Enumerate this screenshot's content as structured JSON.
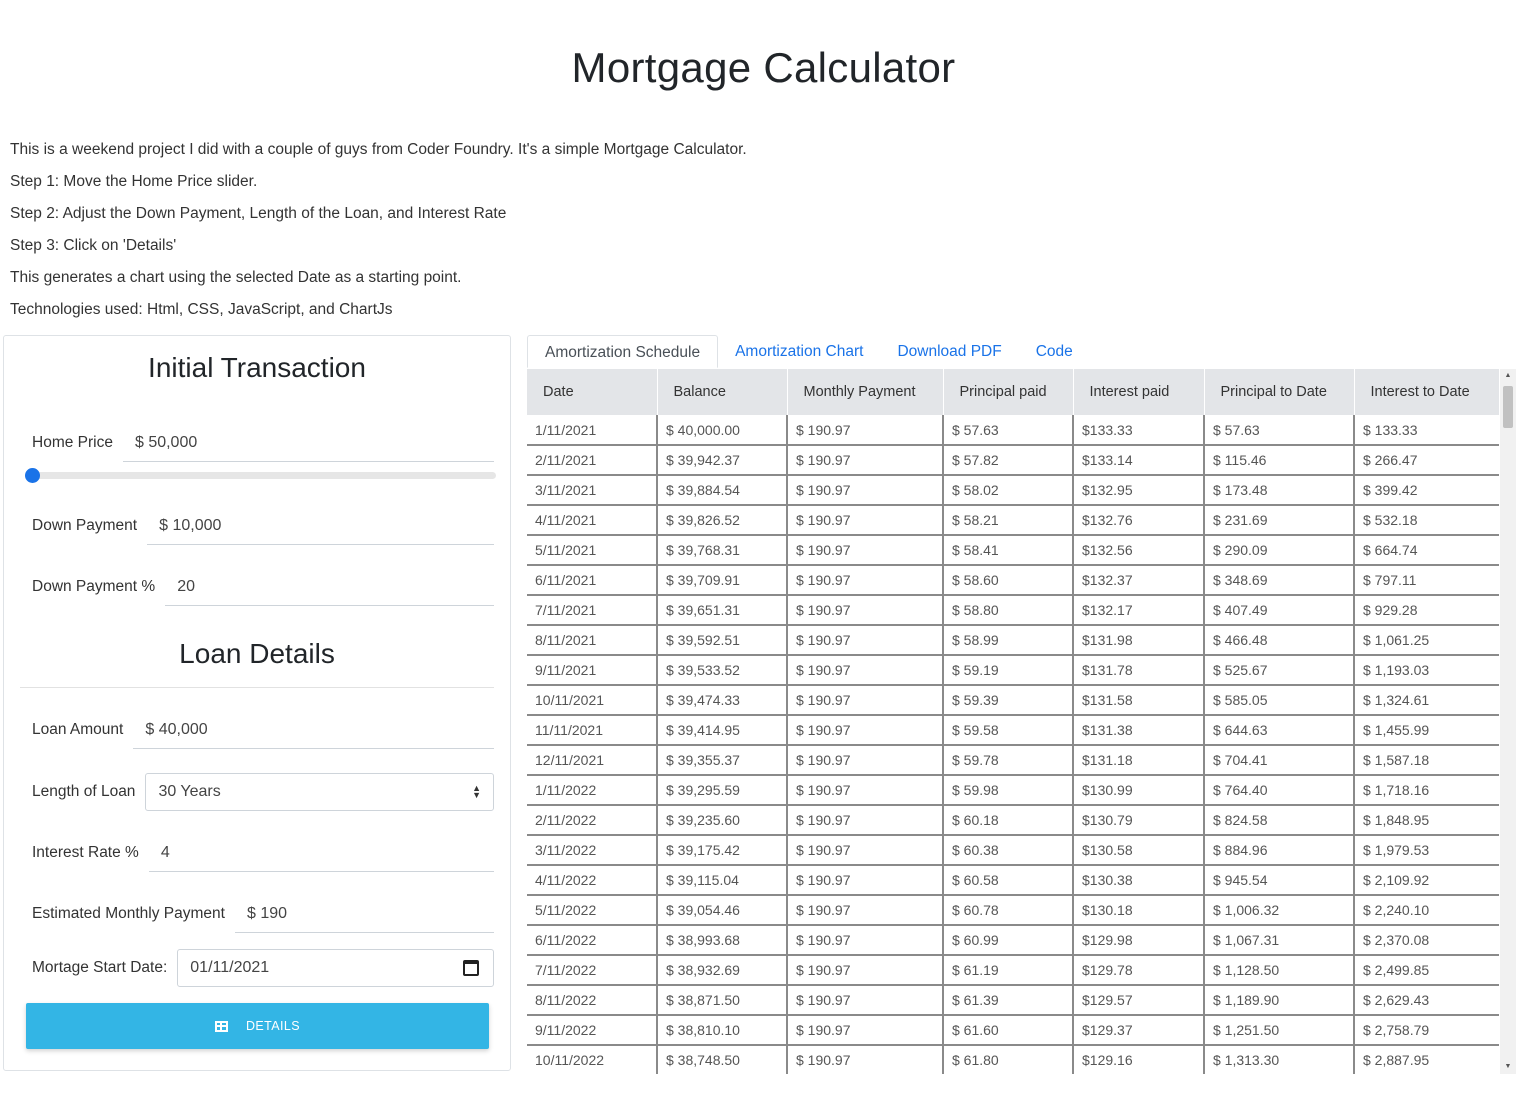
{
  "page": {
    "title": "Mortgage Calculator",
    "intro": [
      "This is a weekend project I did with a couple of guys from Coder Foundry. It's a simple Mortgage Calculator.",
      "Step 1: Move the Home Price slider.",
      "Step 2: Adjust the Down Payment, Length of the Loan, and Interest Rate",
      "Step 3: Click on 'Details'",
      "This generates a chart using the selected Date as a starting point.",
      "Technologies used: Html, CSS, JavaScript, and ChartJs"
    ]
  },
  "initial": {
    "title": "Initial Transaction",
    "home_price_label": "Home Price",
    "home_price_value": "$ 50,000",
    "home_price_slider_fraction": 0.0,
    "down_payment_label": "Down Payment",
    "down_payment_value": "$ 10,000",
    "down_payment_pct_label": "Down Payment %",
    "down_payment_pct_value": "20"
  },
  "loan": {
    "title": "Loan Details",
    "loan_amount_label": "Loan Amount",
    "loan_amount_value": "$ 40,000",
    "length_label": "Length of Loan",
    "length_value": "30 Years",
    "interest_label": "Interest Rate %",
    "interest_value": "4",
    "monthly_label": "Estimated Monthly Payment",
    "monthly_value": "$ 190",
    "start_date_label": "Mortage Start Date:",
    "start_date_value": "01/11/2021",
    "details_button": "Details"
  },
  "tabs": [
    "Amortization Schedule",
    "Amortization Chart",
    "Download PDF",
    "Code"
  ],
  "colors": {
    "accent": "#33b5e5",
    "link": "#1a73e8",
    "header_bg": "#e3e5e8"
  },
  "table": {
    "headers": [
      "Date",
      "Balance",
      "Monthly Payment",
      "Principal paid",
      "Interest paid",
      "Principal to Date",
      "Interest to Date"
    ],
    "rows": [
      [
        "1/11/2021",
        "$ 40,000.00",
        "$ 190.97",
        "$ 57.63",
        "$133.33",
        "$ 57.63",
        "$ 133.33"
      ],
      [
        "2/11/2021",
        "$ 39,942.37",
        "$ 190.97",
        "$ 57.82",
        "$133.14",
        "$ 115.46",
        "$ 266.47"
      ],
      [
        "3/11/2021",
        "$ 39,884.54",
        "$ 190.97",
        "$ 58.02",
        "$132.95",
        "$ 173.48",
        "$ 399.42"
      ],
      [
        "4/11/2021",
        "$ 39,826.52",
        "$ 190.97",
        "$ 58.21",
        "$132.76",
        "$ 231.69",
        "$ 532.18"
      ],
      [
        "5/11/2021",
        "$ 39,768.31",
        "$ 190.97",
        "$ 58.41",
        "$132.56",
        "$ 290.09",
        "$ 664.74"
      ],
      [
        "6/11/2021",
        "$ 39,709.91",
        "$ 190.97",
        "$ 58.60",
        "$132.37",
        "$ 348.69",
        "$ 797.11"
      ],
      [
        "7/11/2021",
        "$ 39,651.31",
        "$ 190.97",
        "$ 58.80",
        "$132.17",
        "$ 407.49",
        "$ 929.28"
      ],
      [
        "8/11/2021",
        "$ 39,592.51",
        "$ 190.97",
        "$ 58.99",
        "$131.98",
        "$ 466.48",
        "$ 1,061.25"
      ],
      [
        "9/11/2021",
        "$ 39,533.52",
        "$ 190.97",
        "$ 59.19",
        "$131.78",
        "$ 525.67",
        "$ 1,193.03"
      ],
      [
        "10/11/2021",
        "$ 39,474.33",
        "$ 190.97",
        "$ 59.39",
        "$131.58",
        "$ 585.05",
        "$ 1,324.61"
      ],
      [
        "11/11/2021",
        "$ 39,414.95",
        "$ 190.97",
        "$ 59.58",
        "$131.38",
        "$ 644.63",
        "$ 1,455.99"
      ],
      [
        "12/11/2021",
        "$ 39,355.37",
        "$ 190.97",
        "$ 59.78",
        "$131.18",
        "$ 704.41",
        "$ 1,587.18"
      ],
      [
        "1/11/2022",
        "$ 39,295.59",
        "$ 190.97",
        "$ 59.98",
        "$130.99",
        "$ 764.40",
        "$ 1,718.16"
      ],
      [
        "2/11/2022",
        "$ 39,235.60",
        "$ 190.97",
        "$ 60.18",
        "$130.79",
        "$ 824.58",
        "$ 1,848.95"
      ],
      [
        "3/11/2022",
        "$ 39,175.42",
        "$ 190.97",
        "$ 60.38",
        "$130.58",
        "$ 884.96",
        "$ 1,979.53"
      ],
      [
        "4/11/2022",
        "$ 39,115.04",
        "$ 190.97",
        "$ 60.58",
        "$130.38",
        "$ 945.54",
        "$ 2,109.92"
      ],
      [
        "5/11/2022",
        "$ 39,054.46",
        "$ 190.97",
        "$ 60.78",
        "$130.18",
        "$ 1,006.32",
        "$ 2,240.10"
      ],
      [
        "6/11/2022",
        "$ 38,993.68",
        "$ 190.97",
        "$ 60.99",
        "$129.98",
        "$ 1,067.31",
        "$ 2,370.08"
      ],
      [
        "7/11/2022",
        "$ 38,932.69",
        "$ 190.97",
        "$ 61.19",
        "$129.78",
        "$ 1,128.50",
        "$ 2,499.85"
      ],
      [
        "8/11/2022",
        "$ 38,871.50",
        "$ 190.97",
        "$ 61.39",
        "$129.57",
        "$ 1,189.90",
        "$ 2,629.43"
      ],
      [
        "9/11/2022",
        "$ 38,810.10",
        "$ 190.97",
        "$ 61.60",
        "$129.37",
        "$ 1,251.50",
        "$ 2,758.79"
      ],
      [
        "10/11/2022",
        "$ 38,748.50",
        "$ 190.97",
        "$ 61.80",
        "$129.16",
        "$ 1,313.30",
        "$ 2,887.95"
      ]
    ]
  }
}
